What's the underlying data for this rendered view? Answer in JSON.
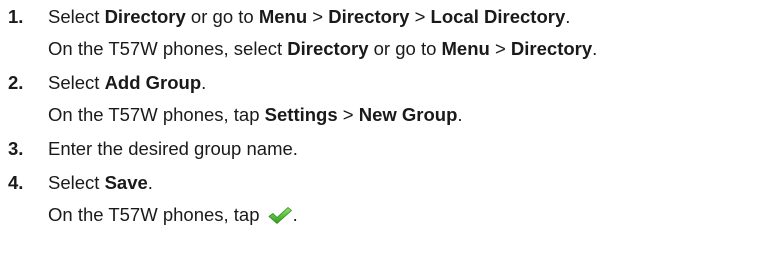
{
  "steps": [
    {
      "number": "1.",
      "line1": {
        "s1": "Select ",
        "b1": "Directory",
        "s2": " or go to ",
        "b2": "Menu",
        "s3": " > ",
        "b3": "Directory",
        "s4": " > ",
        "b4": "Local Directory",
        "s5": "."
      },
      "line2": {
        "s1": "On the T57W phones, select ",
        "b1": "Directory",
        "s2": " or go to ",
        "b2": "Menu",
        "s3": " > ",
        "b3": "Directory",
        "s4": "."
      }
    },
    {
      "number": "2.",
      "line1": {
        "s1": "Select ",
        "b1": "Add Group",
        "s2": "."
      },
      "line2": {
        "s1": "On the T57W phones, tap ",
        "b1": "Settings",
        "s2": " > ",
        "b2": "New Group",
        "s3": "."
      }
    },
    {
      "number": "3.",
      "line1": {
        "s1": "Enter the desired group name."
      }
    },
    {
      "number": "4.",
      "line1": {
        "s1": "Select ",
        "b1": "Save",
        "s2": "."
      },
      "line2": {
        "s1": "On the T57W phones, tap ",
        "icon": "check-icon",
        "s2": "."
      }
    }
  ],
  "colors": {
    "text": "#1a1a1a",
    "check_green_light": "#7ed957",
    "check_green_dark": "#2f9a1e"
  }
}
